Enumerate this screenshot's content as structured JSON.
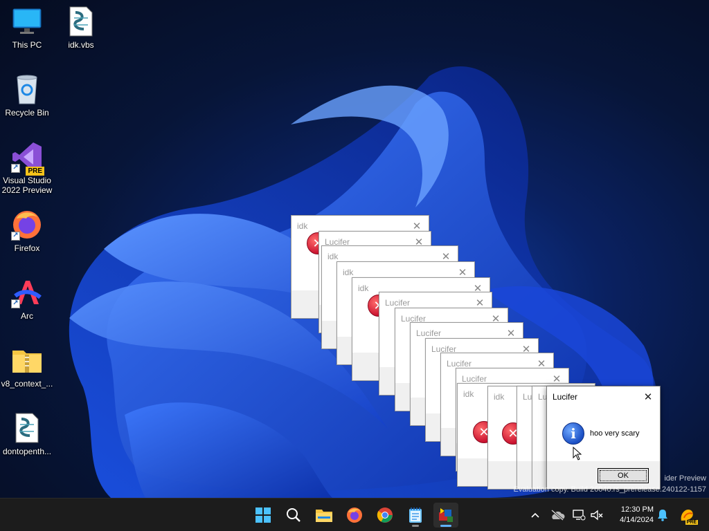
{
  "desktop": {
    "icons": [
      {
        "label": "This PC",
        "icon": "monitor-icon"
      },
      {
        "label": "idk.vbs",
        "icon": "vbs-script-icon"
      },
      {
        "label": "Recycle Bin",
        "icon": "recycle-bin-icon"
      },
      {
        "label": "Visual Studio 2022 Preview",
        "icon": "visual-studio-icon",
        "badge": "PRE"
      },
      {
        "label": "Firefox",
        "icon": "firefox-icon"
      },
      {
        "label": "Arc",
        "icon": "arc-icon"
      },
      {
        "label": "v8_context_...",
        "icon": "zip-folder-icon"
      },
      {
        "label": "dontopenth...",
        "icon": "vbs-script-icon"
      }
    ]
  },
  "dialogs": {
    "stack": [
      {
        "title": "idk"
      },
      {
        "title": "Lucifer"
      },
      {
        "title": "idk"
      },
      {
        "title": "idk"
      },
      {
        "title": "idk"
      },
      {
        "title": "Lucifer"
      },
      {
        "title": "Lucifer"
      },
      {
        "title": "Lucifer"
      },
      {
        "title": "Lucifer"
      },
      {
        "title": "Lucifer"
      },
      {
        "title": "Lucifer"
      },
      {
        "title": "idk"
      },
      {
        "title": "idk"
      },
      {
        "title": "Lu"
      },
      {
        "title": "Lu"
      }
    ],
    "active": {
      "title": "Lucifer",
      "message": "hoo very scary",
      "ok_label": "OK",
      "icon": "info-icon"
    }
  },
  "watermark": {
    "line1": "ider Preview",
    "line2": "Evaluation copy. Build 26040.rs_prerelease.240122-1157"
  },
  "taskbar": {
    "apps": [
      {
        "name": "start-button",
        "icon": "windows-logo-icon"
      },
      {
        "name": "search-button",
        "icon": "search-icon"
      },
      {
        "name": "file-explorer",
        "icon": "folder-icon"
      },
      {
        "name": "firefox",
        "icon": "firefox-icon"
      },
      {
        "name": "chrome",
        "icon": "chrome-icon"
      },
      {
        "name": "notepad",
        "icon": "notepad-icon"
      },
      {
        "name": "script-host",
        "icon": "script-app-icon"
      }
    ],
    "clock": {
      "time": "12:30 PM",
      "date": "4/14/2024"
    },
    "copilot_badge": "PRE"
  },
  "colors": {
    "accent": "#5fb2ff",
    "taskbar_bg": "#1c1c1c",
    "error_red": "#c8102e",
    "info_blue": "#1b4fc4"
  }
}
